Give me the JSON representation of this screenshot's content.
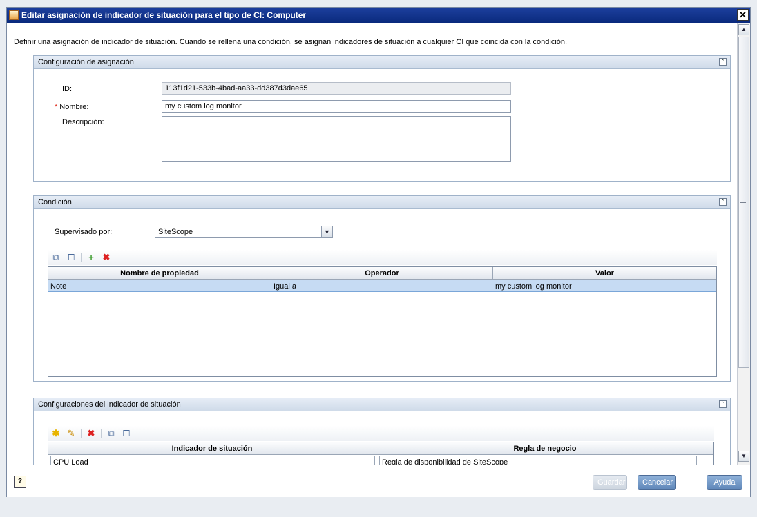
{
  "window": {
    "title": "Editar asignación de indicador de situación para el tipo de CI: Computer",
    "close_glyph": "✕"
  },
  "intro_text": "Definir una asignación de indicador de situación. Cuando se rellena una condición, se asignan indicadores de situación a cualquier CI que coincida con la condición.",
  "assignment_section": {
    "title": "Configuración de asignación",
    "id_label": "ID:",
    "id_value": "113f1d21-533b-4bad-aa33-dd387d3dae65",
    "required_mark": "*",
    "name_label": "Nombre:",
    "name_value": "my custom log monitor",
    "description_label": "Descripción:",
    "description_value": ""
  },
  "condition_section": {
    "title": "Condición",
    "monitored_by_label": "Supervisado por:",
    "monitored_by_value": "SiteScope",
    "columns": [
      "Nombre de propiedad",
      "Operador",
      "Valor"
    ],
    "rows": [
      {
        "property": "Note",
        "operator": "Igual a",
        "value": "my custom log monitor"
      }
    ],
    "toolbar_icons": [
      "select-all-icon",
      "clear-selection-icon",
      "add-icon",
      "delete-icon"
    ]
  },
  "indicators_section": {
    "title": "Configuraciones del indicador de situación",
    "columns": [
      "Indicador de situación",
      "Regla de negocio"
    ],
    "rows": [
      {
        "indicator": "CPU Load",
        "rule": "Regla de disponibilidad de SiteScope"
      }
    ],
    "toolbar_icons": [
      "new-icon",
      "edit-icon",
      "delete-icon",
      "select-all-icon",
      "clear-selection-icon"
    ]
  },
  "footer": {
    "save_label": "Guardar",
    "cancel_label": "Cancelar",
    "help_label": "Ayuda"
  },
  "colors": {
    "titlebar": "#0a2a7d",
    "selected_row": "#c6dbf3",
    "button": "#5f87b9"
  }
}
